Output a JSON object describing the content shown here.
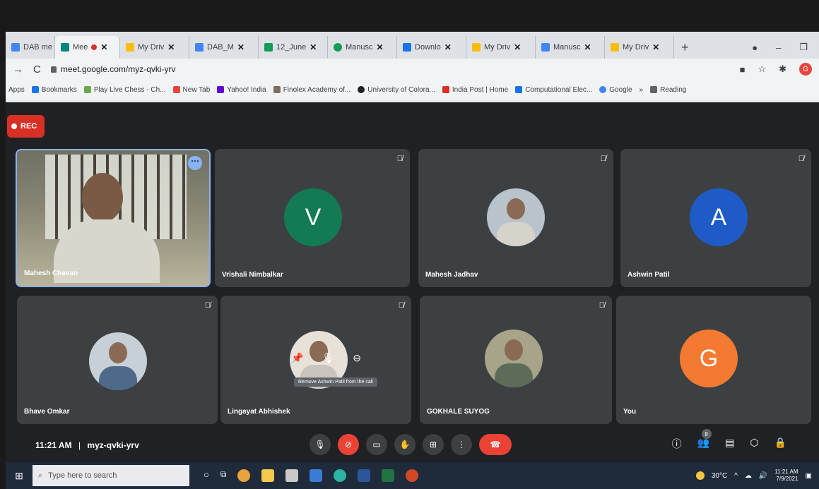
{
  "browser": {
    "tabs": [
      {
        "label": "DAB me",
        "color": "#4285f4"
      },
      {
        "label": "Mee",
        "color": "#00897b",
        "active": true
      },
      {
        "label": "My Driv",
        "color": "#fbbc04"
      },
      {
        "label": "DAB_M",
        "color": "#4285f4"
      },
      {
        "label": "12_June",
        "color": "#0f9d58"
      },
      {
        "label": "Manusc",
        "color": "#0f9d58"
      },
      {
        "label": "Downlo",
        "color": "#1a73e8"
      },
      {
        "label": "My Driv",
        "color": "#fbbc04"
      },
      {
        "label": "Manusc",
        "color": "#4285f4"
      },
      {
        "label": "My Driv",
        "color": "#fbbc04"
      }
    ],
    "url": "meet.google.com/myz-qvki-yrv",
    "profile_initial": "G",
    "bookmarks": [
      {
        "label": "Apps",
        "color": ""
      },
      {
        "label": "Bookmarks",
        "color": "#1a73e8"
      },
      {
        "label": "Play Live Chess - Ch...",
        "color": "#6aa84f"
      },
      {
        "label": "New Tab",
        "color": "#e8453c"
      },
      {
        "label": "Yahoo! India",
        "color": "#6001d2"
      },
      {
        "label": "Finolex Academy of...",
        "color": "#7c6f5b"
      },
      {
        "label": "University of Colora...",
        "color": "#202124"
      },
      {
        "label": "India Post | Home",
        "color": "#d93025"
      },
      {
        "label": "Computational Elec...",
        "color": "#1a73e8"
      },
      {
        "label": "Google",
        "color": "#4285f4"
      },
      {
        "label": "Reading",
        "color": "#5f6368"
      }
    ]
  },
  "meet": {
    "rec_label": "REC",
    "tiles": [
      {
        "name": "Mahesh Chavan",
        "kind": "video"
      },
      {
        "name": "Vrishali Nimbalkar",
        "kind": "letter",
        "letter": "V",
        "color": "#137b53"
      },
      {
        "name": "Mahesh Jadhav",
        "kind": "photo"
      },
      {
        "name": "Ashwin Patil",
        "kind": "letter",
        "letter": "A",
        "color": "#1e5bc6"
      },
      {
        "name": "Bhave Omkar",
        "kind": "photo"
      },
      {
        "name": "Lingayat Abhishek",
        "kind": "photo"
      },
      {
        "name": "GOKHALE SUYOG",
        "kind": "photo"
      },
      {
        "name": "You",
        "kind": "letter",
        "letter": "G",
        "color": "#f47a31"
      }
    ],
    "tooltip": "Remove Ashwin Patil from the call"
  },
  "bottom": {
    "time": "11:21 AM",
    "separator": "|",
    "meeting_code": "myz-qvki-yrv",
    "people_count": "8"
  },
  "taskbar": {
    "search_placeholder": "Type here to search",
    "weather": "30°C",
    "time": "11:21 AM",
    "date": "7/9/2021"
  }
}
